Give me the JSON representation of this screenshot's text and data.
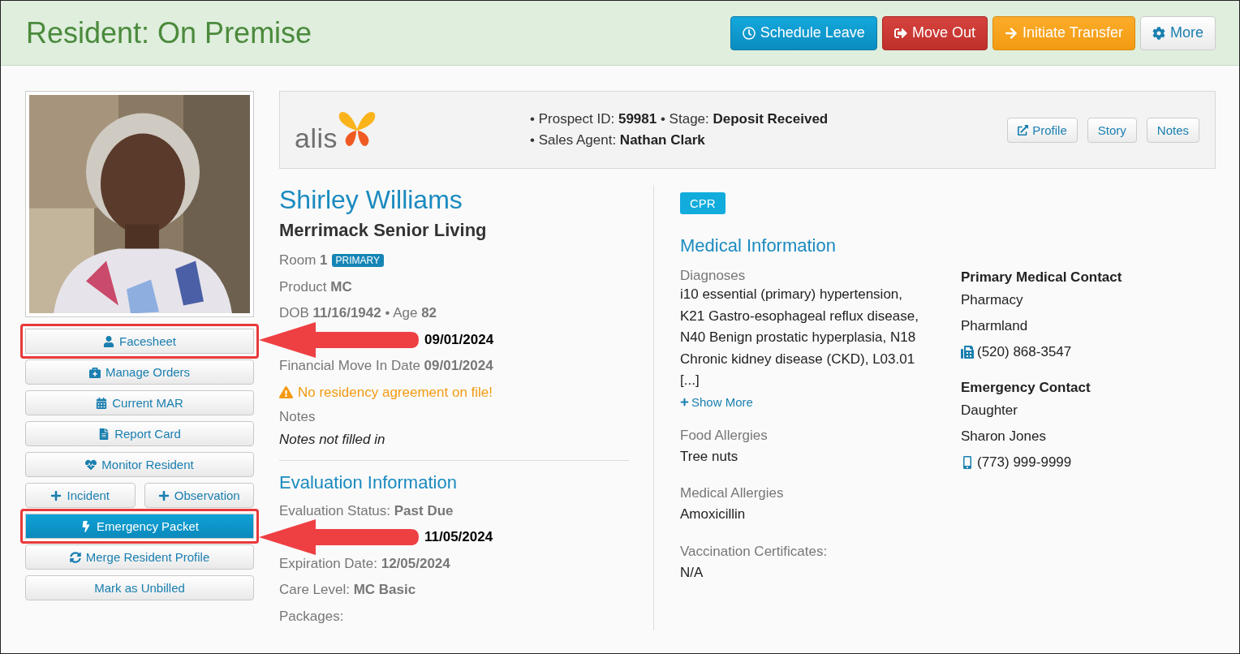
{
  "header": {
    "title": "Resident: On Premise",
    "actions": [
      {
        "label": "Schedule Leave",
        "kind": "info"
      },
      {
        "label": "Move Out",
        "kind": "danger"
      },
      {
        "label": "Initiate Transfer",
        "kind": "warning"
      },
      {
        "label": "More",
        "kind": "default"
      }
    ]
  },
  "sidebar": {
    "actions": [
      {
        "label": "Facesheet",
        "primary": false,
        "highlighted": true
      },
      {
        "label": "Manage Orders",
        "primary": false,
        "highlighted": false
      },
      {
        "label": "Current MAR",
        "primary": false,
        "highlighted": false
      },
      {
        "label": "Report Card",
        "primary": false,
        "highlighted": false
      },
      {
        "label": "Monitor Resident",
        "primary": false,
        "highlighted": false
      },
      {
        "label": "Incident",
        "primary": false,
        "highlighted": false
      },
      {
        "label": "Observation",
        "primary": false,
        "highlighted": false
      },
      {
        "label": "Emergency Packet",
        "primary": true,
        "highlighted": true
      },
      {
        "label": "Merge Resident Profile",
        "primary": false,
        "highlighted": false
      },
      {
        "label": "Mark as Unbilled",
        "primary": false,
        "highlighted": false
      }
    ]
  },
  "prospect_bar": {
    "logo": "alis",
    "lines": [
      "• Prospect ID: **59981** • Stage: **Deposit Received**",
      "• Sales Agent: **Nathan Clark**"
    ],
    "buttons": [
      "Profile",
      "Story",
      "Notes"
    ]
  },
  "resident": {
    "name": "Shirley Williams",
    "community": "Merrimack Senior Living",
    "rows": [
      {
        "text": "Room **1**",
        "badge": "PRIMARY",
        "kind": "plain"
      },
      {
        "text": "Product **MC**",
        "kind": "plain"
      },
      {
        "text": "DOB **11/16/1942** • Age **82**",
        "kind": "plain"
      },
      {
        "text": "**09/01/2024**",
        "kind": "covered"
      },
      {
        "text": "Financial Move In Date **09/01/2024**",
        "kind": "plain"
      }
    ],
    "warning": "No residency agreement on file!",
    "notes_label": "Notes",
    "notes": "Notes not filled in"
  },
  "evaluation": {
    "title": "Evaluation Information",
    "rows": [
      {
        "text": "Evaluation Status: **Past Due**",
        "kind": "status"
      },
      {
        "text": "**11/05/2024**",
        "kind": "covered"
      },
      {
        "text": "Expiration Date: **12/05/2024**",
        "kind": "plain"
      },
      {
        "text": "Care Level: **MC Basic**",
        "kind": "plain"
      },
      {
        "text": "Packages:",
        "kind": "plain"
      }
    ]
  },
  "medical": {
    "badge": "CPR",
    "title": "Medical Information",
    "diagnoses_label": "Diagnoses",
    "diagnoses": "i10 essential (primary) hypertension, K21 Gastro-esophageal reflux disease, N40 Benign prostatic hyperplasia, N18 Chronic kidney disease (CKD), L03.01 [...]",
    "show_more": "Show More",
    "sections": [
      {
        "label": "Food Allergies",
        "value": "Tree nuts"
      },
      {
        "label": "Medical Allergies",
        "value": "Amoxicillin"
      },
      {
        "label": "Vaccination Certificates:",
        "value": "N/A"
      }
    ],
    "contacts": [
      {
        "title": "Primary Medical Contact",
        "lines": [
          "Pharmacy",
          "Pharmland"
        ],
        "phone": "(520) 868-3547",
        "kind": "fax"
      },
      {
        "title": "Emergency Contact",
        "lines": [
          "Daughter",
          "Sharon Jones"
        ],
        "phone": "(773) 999-9999",
        "kind": "mobile"
      }
    ]
  }
}
